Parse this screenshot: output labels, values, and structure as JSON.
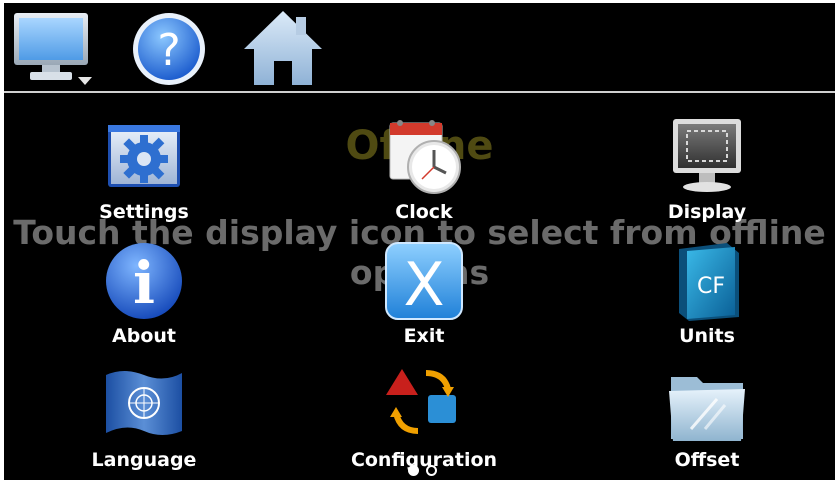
{
  "toolbar": {
    "icons": [
      "monitor-icon",
      "help-icon",
      "home-icon"
    ]
  },
  "background": {
    "title": "Offline",
    "message": "Touch the display icon to select from offline options"
  },
  "menu": {
    "items": [
      {
        "label": "Settings",
        "icon": "settings-icon"
      },
      {
        "label": "Clock",
        "icon": "clock-icon"
      },
      {
        "label": "Display",
        "icon": "display-icon"
      },
      {
        "label": "About",
        "icon": "about-icon"
      },
      {
        "label": "Exit",
        "icon": "exit-icon"
      },
      {
        "label": "Units",
        "icon": "units-icon"
      },
      {
        "label": "Language",
        "icon": "language-flag-icon"
      },
      {
        "label": "Configuration",
        "icon": "configuration-icon"
      },
      {
        "label": "Offset",
        "icon": "offset-folder-icon"
      }
    ]
  },
  "units_icon_text": "CF",
  "exit_icon_text": "X",
  "about_icon_text": "i",
  "help_icon_text": "?",
  "pager": {
    "pages": 2,
    "current": 1
  }
}
